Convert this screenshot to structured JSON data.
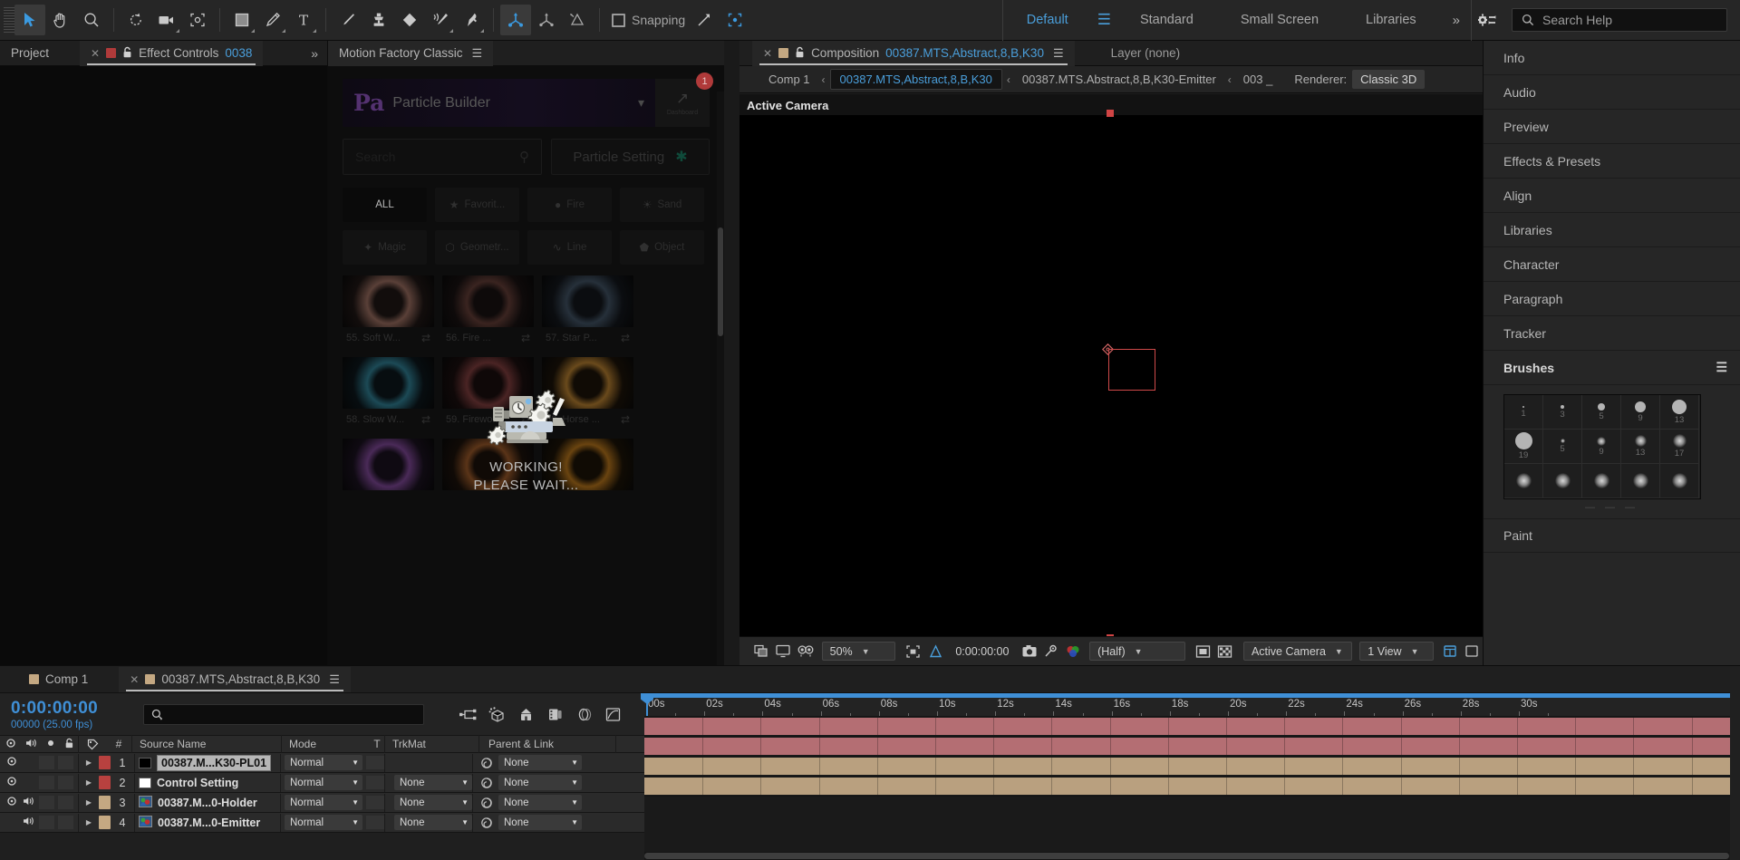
{
  "app": {
    "title": "Adobe After Effects"
  },
  "toolbar": {
    "tools": [
      {
        "name": "selection-tool",
        "icon": "arrow",
        "active": true
      },
      {
        "name": "hand-tool",
        "icon": "hand",
        "active": false
      },
      {
        "name": "zoom-tool",
        "icon": "magnifier",
        "active": false
      },
      {
        "name": "rotation-tool",
        "icon": "rotate",
        "active": false
      },
      {
        "name": "camera-tool",
        "icon": "camera",
        "active": false
      },
      {
        "name": "pan-behind-tool",
        "icon": "anchor-region",
        "active": false
      },
      {
        "name": "shape-tool",
        "icon": "rectangle",
        "active": false
      },
      {
        "name": "pen-tool",
        "icon": "pen",
        "active": false
      },
      {
        "name": "type-tool",
        "icon": "text-T",
        "active": false
      },
      {
        "name": "brush-tool",
        "icon": "brush",
        "active": false
      },
      {
        "name": "clone-stamp-tool",
        "icon": "stamp",
        "active": false
      },
      {
        "name": "eraser-tool",
        "icon": "eraser",
        "active": false
      },
      {
        "name": "roto-brush-tool",
        "icon": "roto-brush",
        "active": false
      },
      {
        "name": "puppet-pin-tool",
        "icon": "puppet-pin",
        "active": false
      }
    ],
    "axis_tools": [
      {
        "name": "local-axis-mode",
        "icon": "axis-local",
        "active": true
      },
      {
        "name": "world-axis-mode",
        "icon": "axis-world",
        "active": false
      },
      {
        "name": "view-axis-mode",
        "icon": "axis-view",
        "active": false
      }
    ],
    "snapping_label": "Snapping",
    "snapping_checked": false,
    "extra_tools": [
      {
        "name": "snap-arrow-icon",
        "icon": "snap-arrow"
      },
      {
        "name": "snap-region-icon",
        "icon": "snap-region"
      }
    ],
    "workspaces": [
      {
        "label": "Default",
        "selected": true
      },
      {
        "label": "Standard",
        "selected": false
      },
      {
        "label": "Small Screen",
        "selected": false
      },
      {
        "label": "Libraries",
        "selected": false
      }
    ],
    "workspace_overflow": "»",
    "sync_settings_icon": "sync-settings-icon",
    "search_help_placeholder": "Search Help"
  },
  "left_panel": {
    "tabs": [
      {
        "label": "Project",
        "active": false,
        "closable": false,
        "swatch": null
      },
      {
        "label": "Effect Controls",
        "suffix": "0038",
        "active": true,
        "closable": true,
        "swatch": "#b03a3a",
        "locked": true
      }
    ],
    "overflow": "»"
  },
  "motion_factory": {
    "tab_label": "Motion Factory Classic",
    "menu_icon": "hamburger-icon",
    "brand": "Pa",
    "product_title": "Particle Builder",
    "dropdown_icon": "chevron-down-icon",
    "dashboard_label": "Dashboard",
    "notification_count": "1",
    "search_placeholder": "Search",
    "search_icon": "search-icon",
    "particle_setting_label": "Particle Setting",
    "particle_setting_icon": "tools-icon",
    "categories": [
      {
        "label": "ALL",
        "icon": "all-icon",
        "active": true
      },
      {
        "label": "Favorit...",
        "icon": "star-icon",
        "active": false
      },
      {
        "label": "Fire",
        "icon": "flame-icon",
        "active": false
      },
      {
        "label": "Sand",
        "icon": "sand-icon",
        "active": false
      },
      {
        "label": "Magic",
        "icon": "magic-wand-icon",
        "active": false
      },
      {
        "label": "Geometr...",
        "icon": "cube-icon",
        "active": false
      },
      {
        "label": "Line",
        "icon": "line-icon",
        "active": false
      },
      {
        "label": "Object",
        "icon": "object-icon",
        "active": false
      }
    ],
    "presets": [
      {
        "label": "55. Soft W...",
        "swap_icon": "swap-icon",
        "tone": "#3a2a26"
      },
      {
        "label": "56. Fire ...",
        "swap_icon": "swap-icon",
        "tone": "#2a2020"
      },
      {
        "label": "57. Star P...",
        "swap_icon": "swap-icon",
        "tone": "#1e2226"
      },
      {
        "label": "58. Slow W...",
        "swap_icon": "swap-icon",
        "tone": "#16262c"
      },
      {
        "label": "59. Firewo...",
        "swap_icon": "swap-icon",
        "tone": "#2e1a1a"
      },
      {
        "label": "60. Horse ...",
        "swap_icon": "swap-icon",
        "tone": "#3a2a16"
      },
      {
        "label": "",
        "swap_icon": "",
        "tone": "#241828"
      },
      {
        "label": "",
        "swap_icon": "",
        "tone": "#2a1c12"
      },
      {
        "label": "",
        "swap_icon": "",
        "tone": "#32230f"
      }
    ],
    "working_line1": "WORKING!",
    "working_line2": "PLEASE WAIT...",
    "working_icon": "machine-gears-icon"
  },
  "composition": {
    "tab": {
      "close_icon": "close-icon",
      "swatch": "#c4a882",
      "lock_icon": "lock-icon",
      "prefix": "Composition",
      "name": "00387.MTS,Abstract,8,B,K30",
      "menu_icon": "hamburger-icon"
    },
    "layer_tab": "Layer  (none)",
    "breadcrumb": [
      {
        "label": "Comp 1",
        "active": false
      },
      {
        "label": "00387.MTS,Abstract,8,B,K30",
        "active": true
      },
      {
        "label": "00387.MTS.Abstract,8,B,K30-Emitter",
        "active": false
      },
      {
        "label": "003 _",
        "active": false
      }
    ],
    "breadcrumb_sep": "‹",
    "renderer_label": "Renderer:",
    "renderer_value": "Classic 3D",
    "active_camera_label": "Active Camera",
    "bottom_bar": {
      "zoom": "50%",
      "timecode": "0:00:00:00",
      "resolution": "(Half)",
      "view": "Active Camera",
      "view_layout": "1 View",
      "icons": [
        "always-preview-icon",
        "show-channel-icon",
        "mask-view-icon",
        "region-of-interest-icon",
        "grid-guides-icon",
        "take-snapshot-icon",
        "show-snapshot-icon",
        "show-channel-rgb-icon",
        "transparency-grid-icon",
        "toggle-pixel-aspect-icon",
        "timeline-sync-icon",
        "comp-flowchart-icon"
      ]
    }
  },
  "right_panels": [
    {
      "label": "Info",
      "header": false
    },
    {
      "label": "Audio",
      "header": false
    },
    {
      "label": "Preview",
      "header": false
    },
    {
      "label": "Effects & Presets",
      "header": false
    },
    {
      "label": "Align",
      "header": false
    },
    {
      "label": "Libraries",
      "header": false
    },
    {
      "label": "Character",
      "header": false
    },
    {
      "label": "Paragraph",
      "header": false
    },
    {
      "label": "Tracker",
      "header": false
    },
    {
      "label": "Brushes",
      "header": true,
      "menu_icon": "hamburger-icon"
    }
  ],
  "brushes": {
    "rows": [
      [
        {
          "size": "1",
          "d": 2,
          "soft": false
        },
        {
          "size": "3",
          "d": 4,
          "soft": false
        },
        {
          "size": "5",
          "d": 8,
          "soft": false
        },
        {
          "size": "9",
          "d": 12,
          "soft": false
        },
        {
          "size": "13",
          "d": 16,
          "soft": false
        }
      ],
      [
        {
          "size": "19",
          "d": 19,
          "soft": false
        },
        {
          "size": "5",
          "d": 5,
          "soft": true
        },
        {
          "size": "9",
          "d": 10,
          "soft": true
        },
        {
          "size": "13",
          "d": 13,
          "soft": true
        },
        {
          "size": "17",
          "d": 15,
          "soft": true
        }
      ],
      [
        {
          "size": "",
          "d": 17,
          "soft": true
        },
        {
          "size": "",
          "d": 17,
          "soft": true
        },
        {
          "size": "",
          "d": 17,
          "soft": true
        },
        {
          "size": "",
          "d": 17,
          "soft": true
        },
        {
          "size": "",
          "d": 17,
          "soft": true
        }
      ]
    ],
    "more_dots": "— — —"
  },
  "paint_panel": {
    "label": "Paint"
  },
  "timeline": {
    "tabs": [
      {
        "label": "Comp 1",
        "active": false,
        "swatch": "#c4a882",
        "closable": false
      },
      {
        "label": "00387.MTS,Abstract,8,B,K30",
        "active": true,
        "swatch": "#c4a882",
        "closable": true
      }
    ],
    "menu_icon": "hamburger-icon",
    "current_time": "0:00:00:00",
    "frame_info": "00000 (25.00 fps)",
    "search_placeholder": "",
    "search_icon": "search-icon",
    "tool_icons": [
      "composition-mini-flowchart-icon",
      "draft-3d-icon",
      "hide-shy-layers-icon",
      "frame-blending-icon",
      "motion-blur-icon",
      "graph-editor-icon"
    ],
    "columns": [
      {
        "label": "",
        "name": "video-toggle-col"
      },
      {
        "label": "",
        "name": "audio-toggle-col"
      },
      {
        "label": "",
        "name": "solo-col"
      },
      {
        "label": "",
        "name": "lock-col"
      },
      {
        "label": "",
        "name": "label-col"
      },
      {
        "label": "#",
        "name": "index-col"
      },
      {
        "label": "Source Name",
        "name": "source-name-col"
      },
      {
        "label": "Mode",
        "name": "mode-col"
      },
      {
        "label": "T",
        "name": "preserve-transparency-col"
      },
      {
        "label": "TrkMat",
        "name": "track-matte-col"
      },
      {
        "label": "Parent & Link",
        "name": "parent-link-col"
      }
    ],
    "layers": [
      {
        "index": "1",
        "name": "00387.M...K30-PL01",
        "mode": "Normal",
        "trkmat": "",
        "parent": "None",
        "label_color": "#b8413f",
        "video": true,
        "audio": false,
        "selected": true,
        "icon": "solid-black",
        "type": "solid"
      },
      {
        "index": "2",
        "name": "Control Setting",
        "mode": "Normal",
        "trkmat": "None",
        "parent": "None",
        "label_color": "#b8413f",
        "video": true,
        "audio": false,
        "selected": false,
        "icon": "solid-white",
        "type": "solid"
      },
      {
        "index": "3",
        "name": "00387.M...0-Holder",
        "mode": "Normal",
        "trkmat": "None",
        "parent": "None",
        "label_color": "#c4a882",
        "video": true,
        "audio": true,
        "selected": false,
        "icon": "comp",
        "type": "comp"
      },
      {
        "index": "4",
        "name": "00387.M...0-Emitter",
        "mode": "Normal",
        "trkmat": "None",
        "parent": "None",
        "label_color": "#c4a882",
        "video": false,
        "audio": true,
        "selected": false,
        "icon": "comp",
        "type": "comp"
      }
    ],
    "ruler_ticks": [
      "00s",
      "02s",
      "04s",
      "06s",
      "08s",
      "10s",
      "12s",
      "14s",
      "16s",
      "18s",
      "20s",
      "22s",
      "24s",
      "26s",
      "28s",
      "30s"
    ],
    "track_colors": [
      "#b46e73",
      "#b46e73",
      "#b9a07f",
      "#b9a07f"
    ]
  }
}
